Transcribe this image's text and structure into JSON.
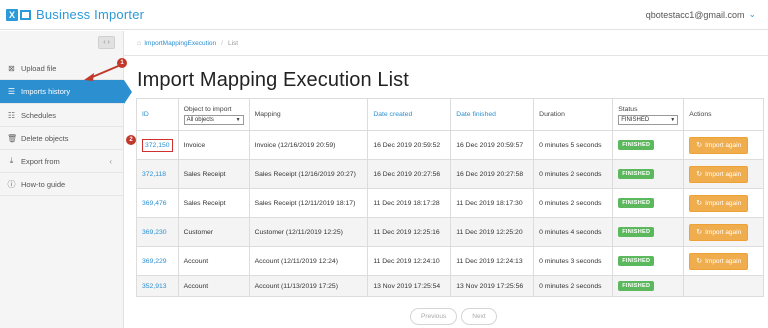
{
  "app": {
    "title": "Business Importer",
    "user_email": "qbotestacc1@gmail.com",
    "user_caret": "⌄"
  },
  "sidebar": {
    "collapse_label": "‹ ›",
    "items": [
      {
        "label": "Upload file",
        "icon": "upload-file-icon"
      },
      {
        "label": "Imports history",
        "icon": "list-icon",
        "active": true
      },
      {
        "label": "Schedules",
        "icon": "schedule-icon"
      },
      {
        "label": "Delete objects",
        "icon": "trash-icon"
      },
      {
        "label": "Export from",
        "icon": "download-icon",
        "chevron": "‹"
      },
      {
        "label": "How-to guide",
        "icon": "info-icon"
      }
    ]
  },
  "annotations": {
    "badge1": "1",
    "badge2": "2"
  },
  "breadcrumb": {
    "link": "ImportMappingExecution",
    "sep": "/",
    "current": "List"
  },
  "page": {
    "title": "Import Mapping Execution List"
  },
  "table": {
    "headers": {
      "id": "ID",
      "object": "Object to import",
      "object_filter": "All objects",
      "mapping": "Mapping",
      "date_created": "Date created",
      "date_finished": "Date finished",
      "duration": "Duration",
      "status": "Status",
      "status_filter": "FINISHED",
      "actions": "Actions"
    },
    "rows": [
      {
        "id": "372,150",
        "object": "Invoice",
        "mapping": "Invoice (12/16/2019 20:59)",
        "created": "16 Dec 2019 20:59:52",
        "finished": "16 Dec 2019 20:59:57",
        "duration": "0 minutes 5 seconds",
        "status": "FINISHED",
        "action": "Import again"
      },
      {
        "id": "372,118",
        "object": "Sales Receipt",
        "mapping": "Sales Receipt (12/16/2019 20:27)",
        "created": "16 Dec 2019 20:27:56",
        "finished": "16 Dec 2019 20:27:58",
        "duration": "0 minutes 2 seconds",
        "status": "FINISHED",
        "action": "Import again"
      },
      {
        "id": "369,476",
        "object": "Sales Receipt",
        "mapping": "Sales Receipt (12/11/2019 18:17)",
        "created": "11 Dec 2019 18:17:28",
        "finished": "11 Dec 2019 18:17:30",
        "duration": "0 minutes 2 seconds",
        "status": "FINISHED",
        "action": "Import again"
      },
      {
        "id": "369,230",
        "object": "Customer",
        "mapping": "Customer (12/11/2019 12:25)",
        "created": "11 Dec 2019 12:25:16",
        "finished": "11 Dec 2019 12:25:20",
        "duration": "0 minutes 4 seconds",
        "status": "FINISHED",
        "action": "Import again"
      },
      {
        "id": "369,229",
        "object": "Account",
        "mapping": "Account (12/11/2019 12:24)",
        "created": "11 Dec 2019 12:24:10",
        "finished": "11 Dec 2019 12:24:13",
        "duration": "0 minutes 3 seconds",
        "status": "FINISHED",
        "action": "Import again"
      },
      {
        "id": "352,913",
        "object": "Account",
        "mapping": "Account (11/13/2019 17:25)",
        "created": "13 Nov 2019 17:25:54",
        "finished": "13 Nov 2019 17:25:56",
        "duration": "0 minutes 2 seconds",
        "status": "FINISHED",
        "action": ""
      }
    ]
  },
  "pager": {
    "previous": "Previous",
    "next": "Next"
  },
  "colors": {
    "accent": "#2c8fd0",
    "finished": "#5cb85c",
    "import_btn": "#f0ad4e",
    "annotation": "#c0392b"
  }
}
